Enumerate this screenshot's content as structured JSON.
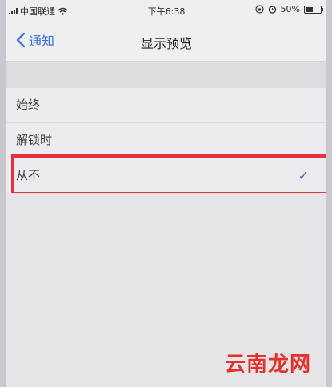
{
  "status_bar": {
    "carrier": "中国联通",
    "time": "下午6:38",
    "battery": "50%",
    "wifi_icon": "wifi-icon",
    "lock_icon": "orientation-lock-icon",
    "alarm_icon": "alarm-icon"
  },
  "nav": {
    "back_label": "通知",
    "title": "显示预览"
  },
  "options": [
    {
      "label": "始终",
      "selected": false
    },
    {
      "label": "解锁时",
      "selected": false
    },
    {
      "label": "从不",
      "selected": true
    }
  ],
  "checkmark": "✓",
  "highlight_color": "#e5333d",
  "accent_color": "#3a6fd6",
  "watermark": "云南龙网"
}
